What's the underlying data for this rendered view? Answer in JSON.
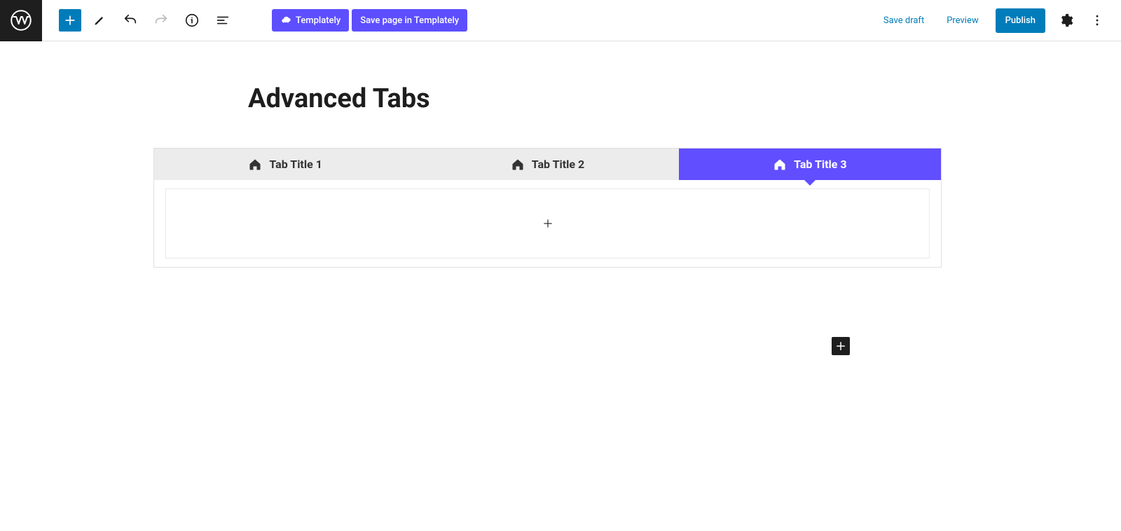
{
  "toolbar": {
    "templately_label": "Templately",
    "save_page_templately_label": "Save page in Templately",
    "save_draft_label": "Save draft",
    "preview_label": "Preview",
    "publish_label": "Publish"
  },
  "page": {
    "title": "Advanced Tabs"
  },
  "tabs": {
    "items": [
      {
        "label": "Tab Title 1",
        "active": false
      },
      {
        "label": "Tab Title 2",
        "active": false
      },
      {
        "label": "Tab Title 3",
        "active": true
      }
    ]
  },
  "colors": {
    "primary_purple": "#614eff",
    "wp_blue": "#007cba"
  }
}
